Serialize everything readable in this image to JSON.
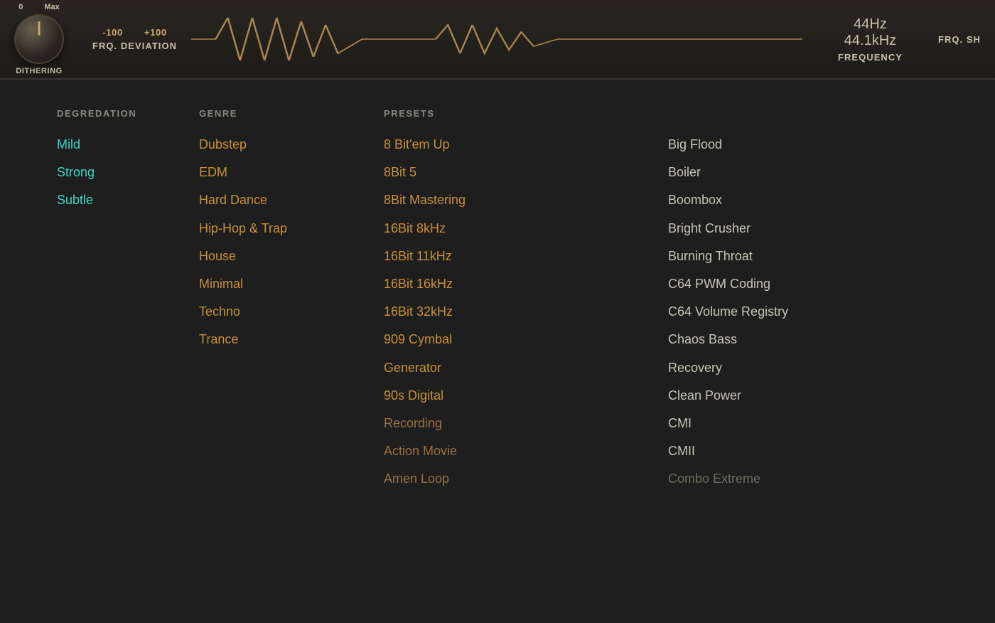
{
  "topPanel": {
    "knob1": {
      "label": "DITHERING",
      "rangeMin": "0",
      "rangeMax": "Max"
    },
    "frdDeviation": {
      "label": "FRQ. DEVIATION",
      "rangeMin": "-100",
      "rangeMax": "+100"
    },
    "frequency": {
      "label": "FREQUENCY",
      "value1": "44Hz",
      "value2": "44.1kHz"
    },
    "frdShape": {
      "label": "FRQ. SH"
    }
  },
  "columns": {
    "degradation": {
      "header": "DEGREDATION",
      "items": [
        {
          "label": "Mild",
          "style": "cyan"
        },
        {
          "label": "Strong",
          "style": "cyan"
        },
        {
          "label": "Subtle",
          "style": "cyan"
        }
      ]
    },
    "genre": {
      "header": "GENRE",
      "items": [
        {
          "label": "Dubstep",
          "style": "orange"
        },
        {
          "label": "EDM",
          "style": "orange"
        },
        {
          "label": "Hard Dance",
          "style": "orange"
        },
        {
          "label": "Hip-Hop & Trap",
          "style": "orange"
        },
        {
          "label": "House",
          "style": "orange"
        },
        {
          "label": "Minimal",
          "style": "orange"
        },
        {
          "label": "Techno",
          "style": "orange"
        },
        {
          "label": "Trance",
          "style": "orange"
        }
      ]
    },
    "presets1": {
      "header": "PRESETS",
      "items": [
        {
          "label": "8 Bit'em Up",
          "style": "orange"
        },
        {
          "label": "8Bit 5",
          "style": "orange"
        },
        {
          "label": "8Bit Mastering",
          "style": "orange"
        },
        {
          "label": "16Bit 8kHz",
          "style": "orange"
        },
        {
          "label": "16Bit 11kHz",
          "style": "orange"
        },
        {
          "label": "16Bit 16kHz",
          "style": "orange"
        },
        {
          "label": "16Bit 32kHz",
          "style": "orange"
        },
        {
          "label": "909 Cymbal",
          "style": "orange"
        },
        {
          "label": "Generator",
          "style": "orange"
        },
        {
          "label": "90s Digital",
          "style": "orange"
        },
        {
          "label": "Recording",
          "style": "muted-orange"
        },
        {
          "label": "Action Movie",
          "style": "muted-orange"
        },
        {
          "label": "Amen Loop",
          "style": "muted-orange"
        }
      ]
    },
    "presets2": {
      "items": [
        {
          "label": "Big Flood",
          "style": "light-gray"
        },
        {
          "label": "Boiler",
          "style": "light-gray"
        },
        {
          "label": "Boombox",
          "style": "light-gray"
        },
        {
          "label": "Bright Crusher",
          "style": "light-gray"
        },
        {
          "label": "Burning Throat",
          "style": "light-gray"
        },
        {
          "label": "C64 PWM Coding",
          "style": "light-gray"
        },
        {
          "label": "C64 Volume Registry",
          "style": "light-gray"
        },
        {
          "label": "Chaos Bass",
          "style": "light-gray"
        },
        {
          "label": "Recovery",
          "style": "light-gray"
        },
        {
          "label": "Clean Power",
          "style": "light-gray"
        },
        {
          "label": "CMI",
          "style": "light-gray"
        },
        {
          "label": "CMII",
          "style": "light-gray"
        },
        {
          "label": "Combo Extreme",
          "style": "muted-gray"
        }
      ]
    }
  }
}
